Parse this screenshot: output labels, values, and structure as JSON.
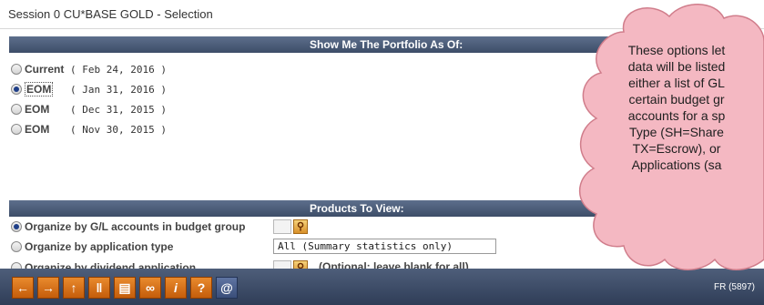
{
  "window": {
    "title": "Session 0 CU*BASE GOLD - Selection"
  },
  "portfolio": {
    "heading": "Show Me The Portfolio As Of:",
    "options": [
      {
        "label": "Current",
        "date": "( Feb 24, 2016 )",
        "selected": false
      },
      {
        "label": "EOM",
        "date": "( Jan 31, 2016 )",
        "selected": true
      },
      {
        "label": "EOM",
        "date": "( Dec 31, 2015 )",
        "selected": false
      },
      {
        "label": "EOM",
        "date": "( Nov 30, 2015 )",
        "selected": false
      }
    ]
  },
  "products": {
    "heading": "Products To View:",
    "options": [
      {
        "label": "Organize by G/L accounts in budget group",
        "selected": true
      },
      {
        "label": "Organize by application type",
        "selected": false
      },
      {
        "label": "Organize by dividend application",
        "selected": false
      }
    ],
    "application_type_value": "All (Summary statistics only)",
    "dividend_note": "(Optional; leave blank for all)"
  },
  "toolbar": {
    "buttons": [
      "back-arrow-icon",
      "forward-arrow-icon",
      "up-arrow-icon",
      "pause-icon",
      "print-icon",
      "link-icon",
      "info-icon",
      "help-icon",
      "at-icon"
    ],
    "status": "FR (5897)"
  },
  "callout": {
    "text": "These options let\ndata will be listed\neither a list of GL\ncertain budget gr\naccounts for a sp\nType (SH=Share\nTX=Escrow), or\nApplications (sa"
  },
  "colors": {
    "accent": "#e37a20",
    "band": "#4a5a76",
    "cloud": "#f4b8c2"
  }
}
